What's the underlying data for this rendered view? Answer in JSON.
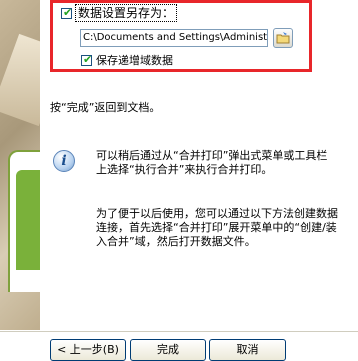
{
  "save_data_settings": {
    "checkbox_label": "数据设置另存为：",
    "checked": true,
    "path_value": "C:\\Documents and Settings\\Administra",
    "store_increment_label": "保存递增域数据",
    "store_increment_checked": true
  },
  "finish_hint": "按“完成”返回到文档。",
  "info": {
    "paragraph1": "可以稍后通过从“合并打印”弹出式菜单或工具栏上选择“执行合并”来执行合并打印。",
    "paragraph2": "为了便于以后使用，您可以通过以下方法创建数据连接，首先选择“合并打印”展开菜单中的“创建/装入合并”域，然后打开数据文件。"
  },
  "buttons": {
    "back": "< 上一步(B)",
    "finish": "完成",
    "cancel": "取消"
  },
  "colors": {
    "highlight_border": "#e8262a",
    "checkmark": "#21a121",
    "button_border": "#003c74"
  }
}
